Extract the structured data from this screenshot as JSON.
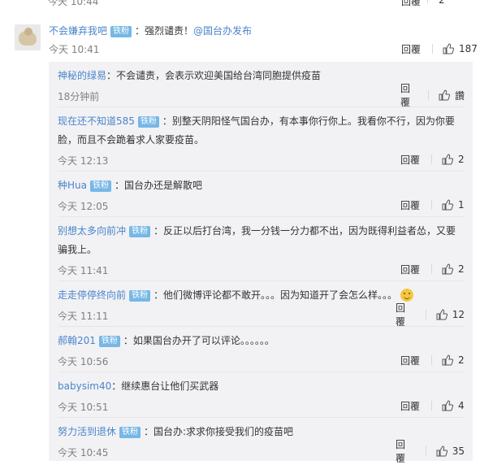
{
  "top_partial": {
    "time": "今天 10:44",
    "reply": "回覆",
    "likes": "2"
  },
  "main_comment": {
    "user": "不会嫌弃我吧",
    "badge": "铁粉",
    "text": "：强烈谴责！",
    "mention": "@国台办发布",
    "time": "今天 10:41",
    "reply_label": "回覆",
    "likes": "187"
  },
  "replies": [
    {
      "user": "神秘的绿易",
      "badge": "",
      "text": "：不会谴责，会表示欢迎美国给台湾同胞提供疫苗",
      "time": "18分钟前",
      "reply_label": "回覆",
      "likes": "讚"
    },
    {
      "user": "现在还不知道585",
      "badge": "铁粉",
      "text": "：别整天阴阳怪气国台办，有本事你行你上。我看你不行，因为你要脸，而且不会跪着求人家要疫苗。",
      "time": "今天 12:13",
      "reply_label": "回覆",
      "likes": "2"
    },
    {
      "user": "种Hua",
      "badge": "铁粉",
      "text": "：国台办还是解散吧",
      "time": "今天 12:05",
      "reply_label": "回覆",
      "likes": "1"
    },
    {
      "user": "别想太多向前冲",
      "badge": "铁粉",
      "text": "：反正以后打台湾，我一分钱一分力都不出，因为既得利益者怂，又要骗我上。",
      "time": "今天 11:41",
      "reply_label": "回覆",
      "likes": "2"
    },
    {
      "user": "走走停停终向前",
      "badge": "铁粉",
      "text": "：他们微博评论都不敢开。。。因为知道开了会怎么样。。。",
      "time": "今天 11:11",
      "reply_label": "回覆",
      "likes": "12",
      "emoji": "smile-emoji"
    },
    {
      "user": "郝翰201",
      "badge": "铁粉",
      "text": "：如果国台办开了可以评论。。。。。。",
      "time": "今天 10:56",
      "reply_label": "回覆",
      "likes": "2"
    },
    {
      "user": "babysim40",
      "badge": "",
      "text": "：继续惠台让他们买武器",
      "time": "今天 10:51",
      "reply_label": "回覆",
      "likes": "4"
    },
    {
      "user": "努力活到退休",
      "badge": "铁粉",
      "text": "：国台办:求求你接受我们的疫苗吧",
      "time": "今天 10:45",
      "reply_label": "回覆",
      "likes": "35"
    }
  ],
  "icons": {
    "like": "thumbs-up-icon"
  }
}
